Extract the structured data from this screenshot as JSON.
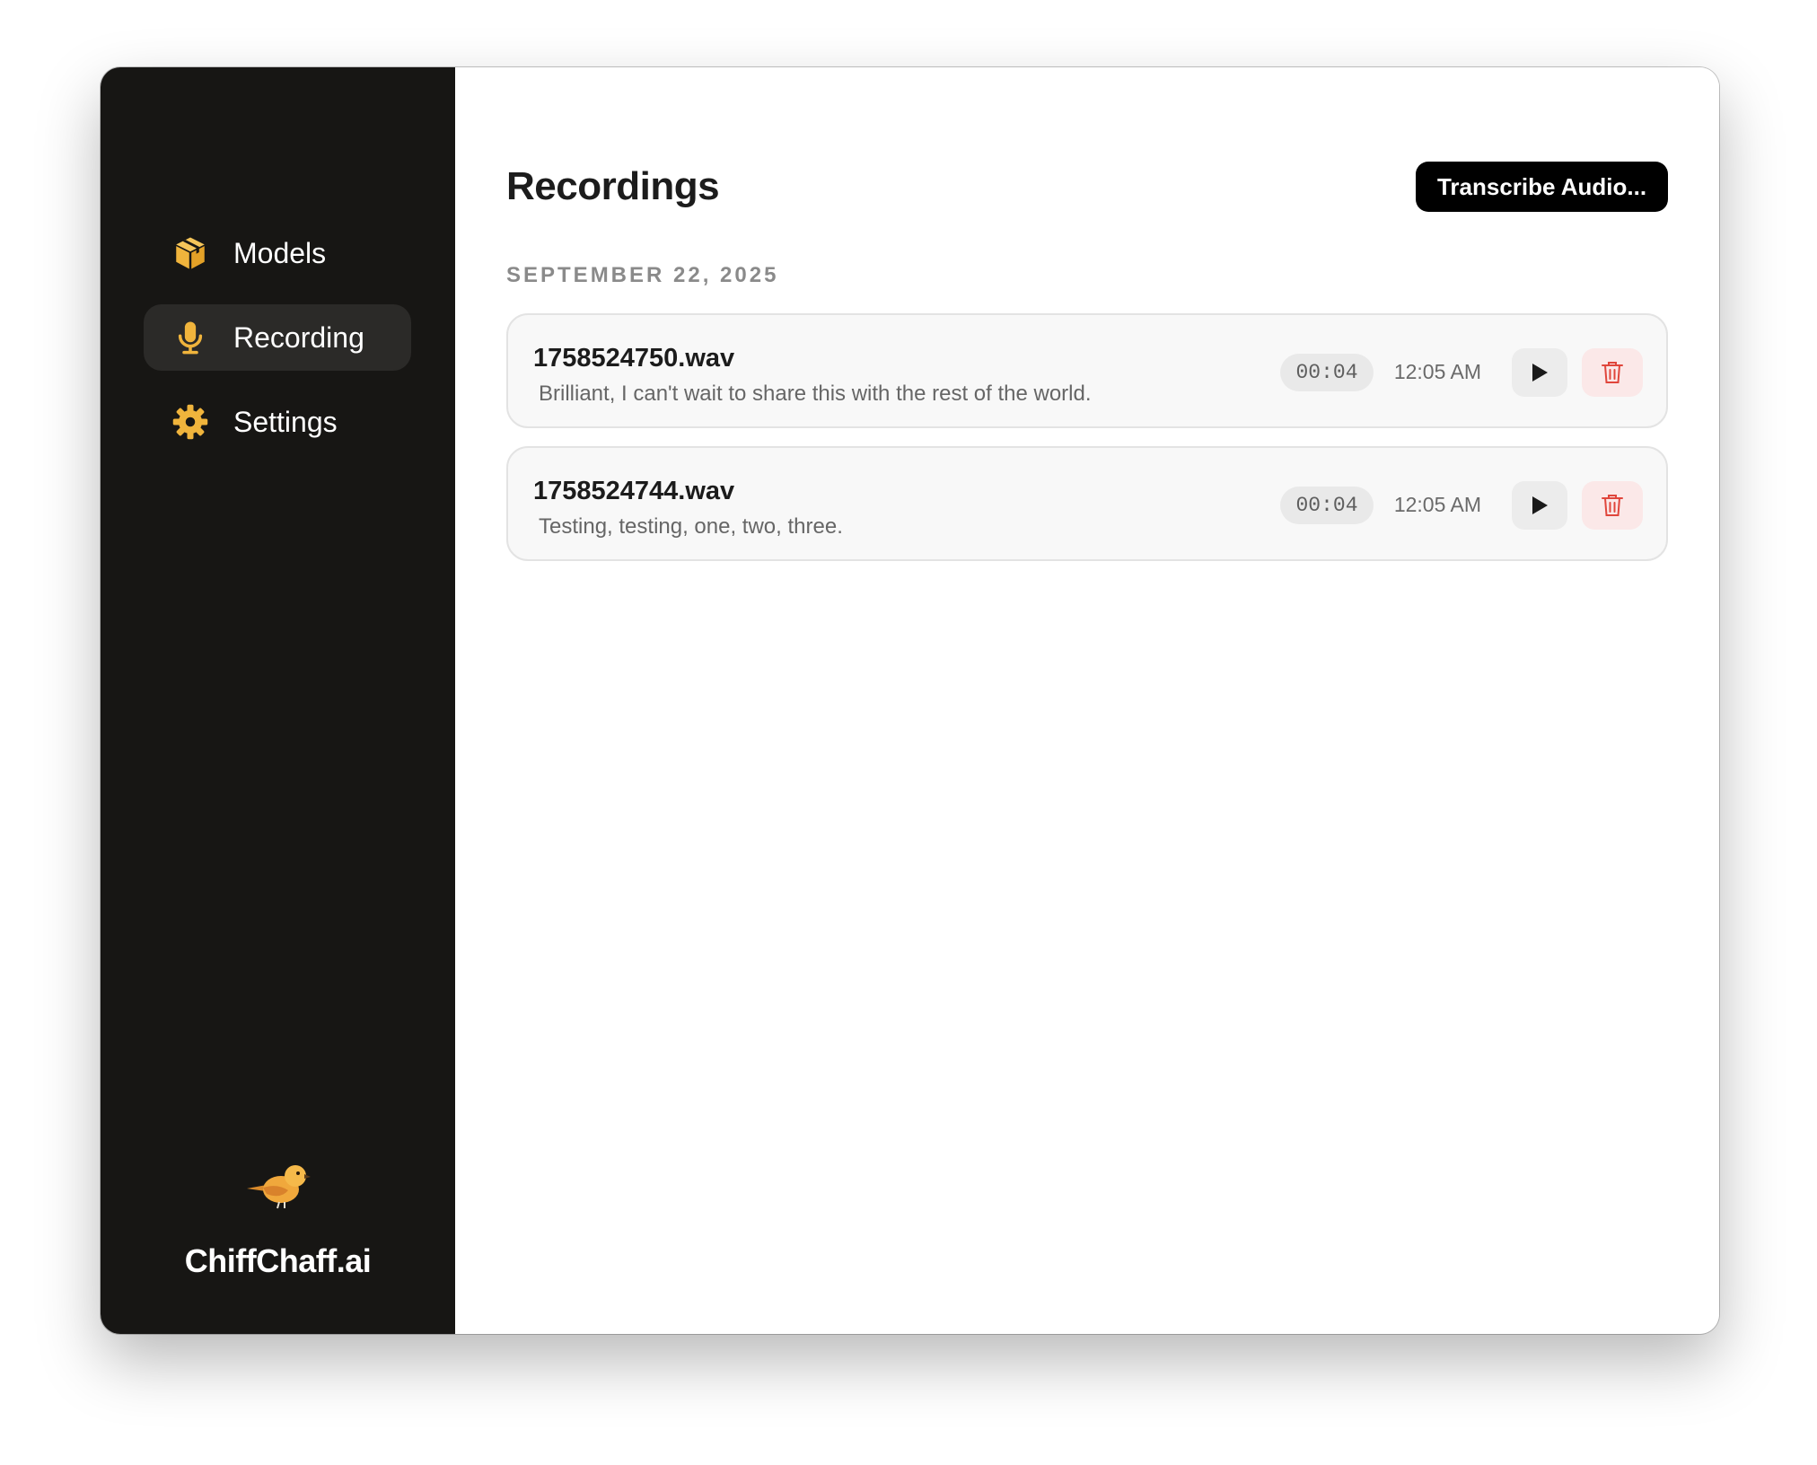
{
  "sidebar": {
    "items": [
      {
        "label": "Models",
        "icon": "package-icon",
        "active": false
      },
      {
        "label": "Recording",
        "icon": "microphone-icon",
        "active": true
      },
      {
        "label": "Settings",
        "icon": "gear-icon",
        "active": false
      }
    ],
    "brand_name": "ChiffChaff.ai",
    "brand_logo": "bird-logo"
  },
  "main": {
    "title": "Recordings",
    "transcribe_button_label": "Transcribe Audio...",
    "date_heading": "SEPTEMBER 22, 2025",
    "recordings": [
      {
        "filename": "1758524750.wav",
        "transcript": "Brilliant, I can't wait to share this with the rest of the world.",
        "duration": "00:04",
        "time": "12:05 AM"
      },
      {
        "filename": "1758524744.wav",
        "transcript": "Testing, testing, one, two, three.",
        "duration": "00:04",
        "time": "12:05 AM"
      }
    ]
  },
  "colors": {
    "sidebar_bg": "#171614",
    "accent": "#f0b43c",
    "delete": "#e0463c",
    "primary_button": "#000000"
  }
}
